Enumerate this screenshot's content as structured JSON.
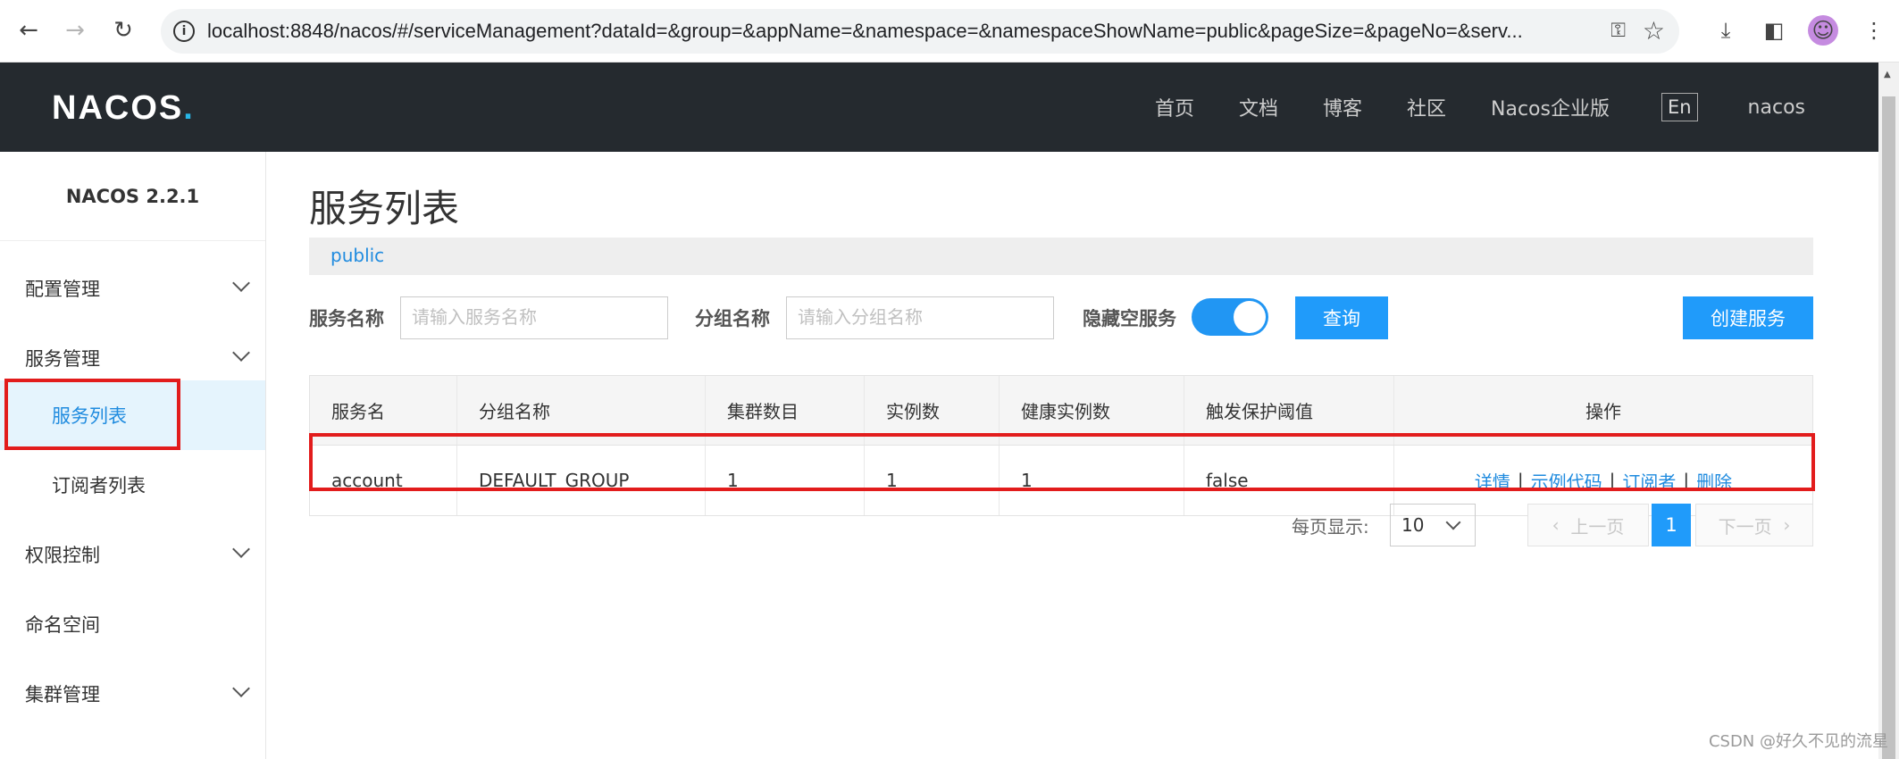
{
  "browser": {
    "url": "localhost:8848/nacos/#/serviceManagement?dataId=&group=&appName=&namespace=&namespaceShowName=public&pageSize=&pageNo=&serv...",
    "back_icon": "←",
    "forward_icon": "→",
    "reload_icon": "↻",
    "info_icon": "i",
    "key_icon": "⚿",
    "star_icon": "☆",
    "download_icon": "⤓",
    "sidepanel_icon": "◧",
    "avatar_icon": "☺",
    "menu_icon": "⋮"
  },
  "header": {
    "logo_main": "NACOS",
    "logo_dot": ".",
    "nav": [
      "首页",
      "文档",
      "博客",
      "社区",
      "Nacos企业版"
    ],
    "lang": "En",
    "user": "nacos"
  },
  "sidebar": {
    "version": "NACOS 2.2.1",
    "items": [
      {
        "label": "配置管理"
      },
      {
        "label": "服务管理"
      },
      {
        "label": "服务列表"
      },
      {
        "label": "订阅者列表"
      },
      {
        "label": "权限控制"
      },
      {
        "label": "命名空间"
      },
      {
        "label": "集群管理"
      }
    ]
  },
  "main": {
    "title": "服务列表",
    "namespace": "public",
    "filters": {
      "service_label": "服务名称",
      "service_placeholder": "请输入服务名称",
      "group_label": "分组名称",
      "group_placeholder": "请输入分组名称",
      "hide_empty_label": "隐藏空服务",
      "hide_empty_on": true,
      "query_button": "查询",
      "create_button": "创建服务"
    },
    "table": {
      "headers": [
        "服务名",
        "分组名称",
        "集群数目",
        "实例数",
        "健康实例数",
        "触发保护阈值",
        "操作"
      ],
      "rows": [
        {
          "name": "account",
          "group": "DEFAULT_GROUP",
          "clusters": "1",
          "instances": "1",
          "healthy": "1",
          "protect": "false",
          "ops": [
            "详情",
            "示例代码",
            "订阅者",
            "删除"
          ],
          "separator": "|"
        }
      ]
    },
    "pagination": {
      "per_page_label": "每页显示:",
      "per_page_value": "10",
      "prev": "上一页",
      "next": "下一页",
      "current": "1"
    }
  },
  "watermark": "CSDN @好久不见的流星",
  "colors": {
    "accent": "#209bfa",
    "header_bg": "#252a2f",
    "highlight": "#e21c1c"
  }
}
